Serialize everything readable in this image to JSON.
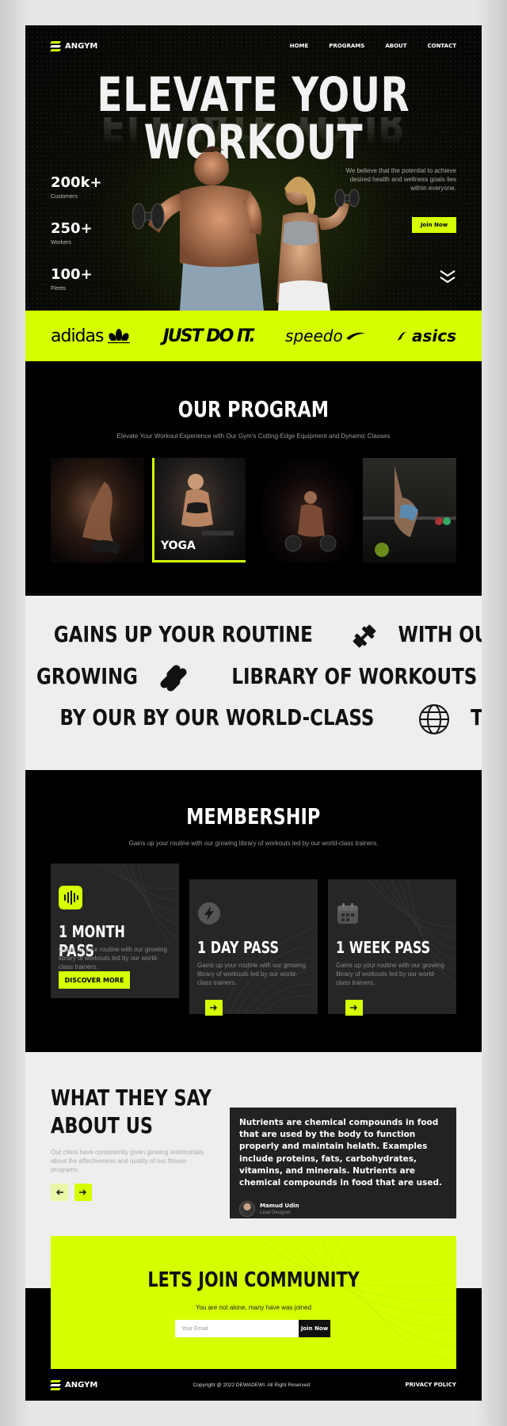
{
  "brand": {
    "name": "ANGYM"
  },
  "nav": {
    "items": [
      "HOME",
      "PROGRAMS",
      "ABOUT",
      "CONTACT"
    ]
  },
  "hero": {
    "title": "ELEVATE YOUR WORKOUT",
    "stats": [
      {
        "value": "200k+",
        "label": "Customers"
      },
      {
        "value": "250+",
        "label": "Workers"
      },
      {
        "value": "100+",
        "label": "Fleets"
      }
    ],
    "description": "We believe that the potential to achieve desired health and wellness goals lies within everyone.",
    "cta": "Join Now"
  },
  "brands": [
    "adidas",
    "JUST DO IT.",
    "speedo",
    "asics"
  ],
  "program": {
    "title": "OUR PROGRAM",
    "subtitle": "Elevate Your Workout Experience with Our Gym's Cutting-Edge Equipment and Dynamic Classes",
    "tiles": [
      {
        "label": ""
      },
      {
        "label": "YOGA"
      },
      {
        "label": ""
      },
      {
        "label": ""
      }
    ]
  },
  "quote": {
    "line1_a": "GAINS UP YOUR ROUTINE",
    "line1_b": "WITH OUR",
    "line2_a": "GROWING",
    "line2_b": "LIBRARY OF WORKOUTS LED",
    "line3_a": "BY OUR BY OUR WORLD-CLASS",
    "line3_b": "TRAINERS"
  },
  "membership": {
    "title": "MEMBERSHIP",
    "subtitle": "Gains up your routine with our growing library of workouts led by our world-class trainers.",
    "cards": [
      {
        "title": "1 MONTH PASS",
        "desc": "Gains up your routine with our growing library of workouts led by our world-class trainers.",
        "button": "DISCOVER MORE",
        "icon": "waveform-icon"
      },
      {
        "title": "1 DAY PASS",
        "desc": "Gains up your routine with our growing library of workouts led by our world-class trainers.",
        "icon": "lightning-icon"
      },
      {
        "title": "1 WEEK PASS",
        "desc": "Gains up your routine with our growing library of workouts led by our world-class trainers.",
        "icon": "calendar-icon"
      }
    ]
  },
  "testimonial": {
    "title_line1": "WHAT THEY SAY",
    "title_line2": "ABOUT US",
    "subtitle": "Our client have consistently given glowing testimonials about the effectiveness and quality of our fitness programs",
    "quote": "Nutrients are chemical compounds in food that are used by the body to function properly and maintain helath. Examples include proteins, fats, carbohydrates, vitamins, and minerals. Nutrients are chemical compounds in food that are used.",
    "author": "Mamud Udin",
    "role": "Lead Designer"
  },
  "community": {
    "title": "LETS JOIN COMMUNITY",
    "subtitle": "You are not alone, many have was joined",
    "email_placeholder": "Your Email",
    "button": "Join Now"
  },
  "footer": {
    "copyright": "Copyright @ 2022 DEWADEWI. All Right Reserved",
    "privacy": "PRIVACY POLICY"
  },
  "colors": {
    "accent": "#d6ff00",
    "dark": "#000000",
    "light": "#eeeeee",
    "card": "#262626"
  }
}
